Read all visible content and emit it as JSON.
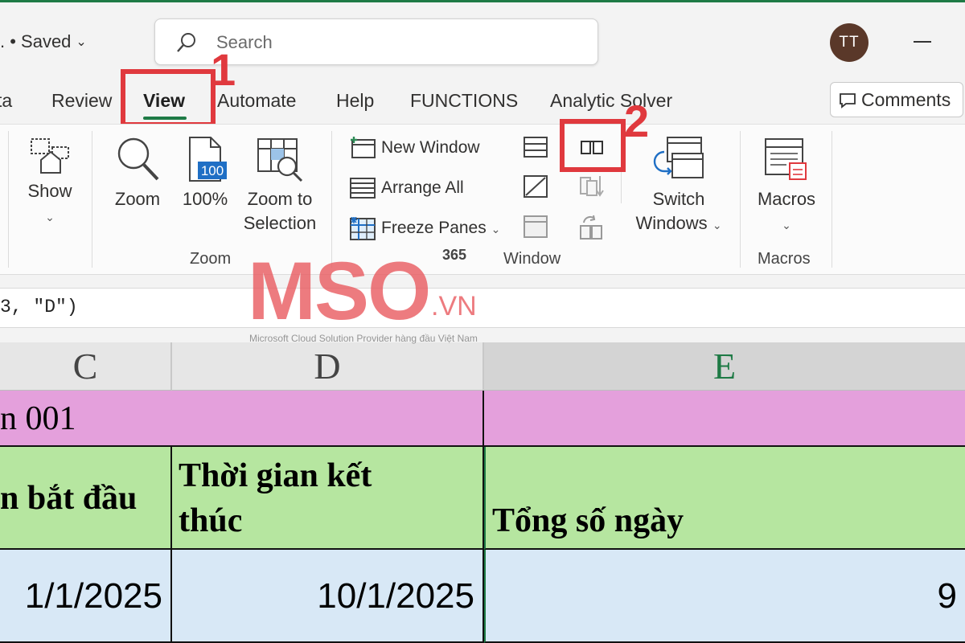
{
  "titlebar": {
    "saved_label": ". • Saved",
    "search_placeholder": "Search",
    "avatar_initials": "TT"
  },
  "tabs": [
    {
      "label": "ta"
    },
    {
      "label": "Review"
    },
    {
      "label": "View"
    },
    {
      "label": "Automate"
    },
    {
      "label": "Help"
    },
    {
      "label": "FUNCTIONS"
    },
    {
      "label": "Analytic Solver"
    }
  ],
  "comments_label": "Comments",
  "ribbon": {
    "show_label": "Show",
    "zoom_label": "Zoom",
    "zoom100_label": "100%",
    "zoom100_badge": "100",
    "zoom_selection_line1": "Zoom to",
    "zoom_selection_line2": "Selection",
    "zoom_group": "Zoom",
    "new_window": "New Window",
    "arrange_all": "Arrange All",
    "freeze_panes": "Freeze Panes",
    "switch_line1": "Switch",
    "switch_line2": "Windows",
    "window_group": "Window",
    "window_badge": "365",
    "macros_label": "Macros",
    "macros_group": "Macros"
  },
  "annotations": {
    "step1": "1",
    "step2": "2"
  },
  "formula": {
    "text": "3, \"D\")"
  },
  "grid": {
    "columns": [
      "C",
      "D",
      "E"
    ],
    "title_row": "n 001",
    "headers": [
      "n bắt đầu",
      "Thời gian kết",
      "thúc",
      "Tổng số ngày"
    ],
    "data_row": [
      "1/1/2025",
      "10/1/2025",
      "9"
    ]
  },
  "watermark": {
    "logo": "MSO",
    "domain": ".VN",
    "tagline": "Microsoft Cloud Solution Provider hàng đầu Việt Nam"
  },
  "colors": {
    "accent": "#1e7a45",
    "annotation": "#e0393e",
    "title_row": "#e4a0dc",
    "header_row": "#b6e6a0",
    "data_row": "#d8e8f6"
  }
}
